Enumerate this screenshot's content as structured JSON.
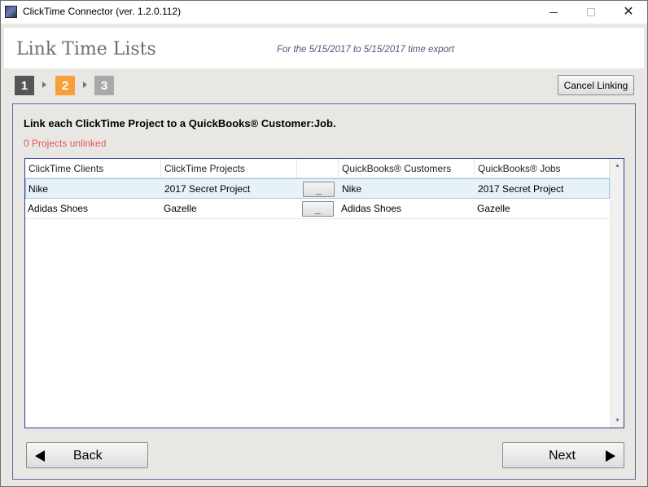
{
  "window": {
    "title": "ClickTime Connector (ver. 1.2.0.112)",
    "icon": "app-icon",
    "controls": {
      "minimize": "minimize-icon",
      "maximize": "maximize-icon",
      "close": "✕"
    }
  },
  "header": {
    "title": "Link Time Lists",
    "export_note": "For the 5/15/2017 to 5/15/2017 time export"
  },
  "steps": [
    {
      "label": "1",
      "color": "#555555"
    },
    {
      "label": "2",
      "color": "#f5a03a",
      "active": true
    },
    {
      "label": "3",
      "color": "#a9a9a9"
    }
  ],
  "cancel_label": "Cancel Linking",
  "main": {
    "instruction": "Link each ClickTime Project to a QuickBooks® Customer:Job.",
    "unlinked_text": "0 Projects unlinked",
    "unlinked_color": "#e05a5a"
  },
  "grid": {
    "columns": [
      "ClickTime Clients",
      "ClickTime Projects",
      "",
      "QuickBooks® Customers",
      "QuickBooks® Jobs"
    ],
    "rows": [
      {
        "client": "Nike",
        "project": "2017 Secret Project",
        "action": "_",
        "customer": "Nike",
        "job": "2017 Secret Project",
        "selected": true
      },
      {
        "client": "Adidas Shoes",
        "project": "Gazelle",
        "action": "_",
        "customer": "Adidas Shoes",
        "job": "Gazelle",
        "selected": false
      }
    ],
    "scroll_up": "▲",
    "scroll_down": "▼"
  },
  "nav": {
    "back_label": "Back",
    "next_label": "Next"
  },
  "colors": {
    "accent": "#f5a03a",
    "panel_border": "#5d6c9a",
    "grid_border": "#2b3b8c",
    "selected_row": "#e7f1fa"
  }
}
